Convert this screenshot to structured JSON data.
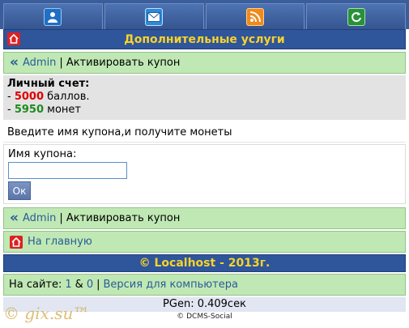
{
  "topnav": {
    "icons": [
      "user-icon",
      "mail-icon",
      "rss-icon",
      "refresh-icon"
    ]
  },
  "header": {
    "title": "Дополнительные услуги"
  },
  "breadcrumb": {
    "user": "Admin",
    "separator": "|",
    "current": "Активировать купон"
  },
  "account": {
    "heading": "Личный счет:",
    "points_prefix": "- ",
    "points_value": "5000",
    "points_unit": "баллов.",
    "coins_prefix": "- ",
    "coins_value": "5950",
    "coins_unit": "монет"
  },
  "prompt": "Введите имя купона,и получите монеты",
  "form": {
    "label": "Имя купона:",
    "input_value": "",
    "submit_label": "Ок"
  },
  "home_link": "На главную",
  "footer": "© Localhost - 2013г.",
  "online": {
    "prefix": "На сайте:",
    "count1": "1",
    "amp": "&",
    "count2": "0",
    "separator": "|",
    "desktop_link": "Версия для компьютера"
  },
  "pgen": "PGen: 0.409сек",
  "copyright": "© DCMS-Social",
  "watermark": "© gix.su™",
  "colors": {
    "header_bg": "#2f559a",
    "header_text": "#f8d32b",
    "panel_green": "#c0e8b4",
    "link": "#2a5d96"
  }
}
